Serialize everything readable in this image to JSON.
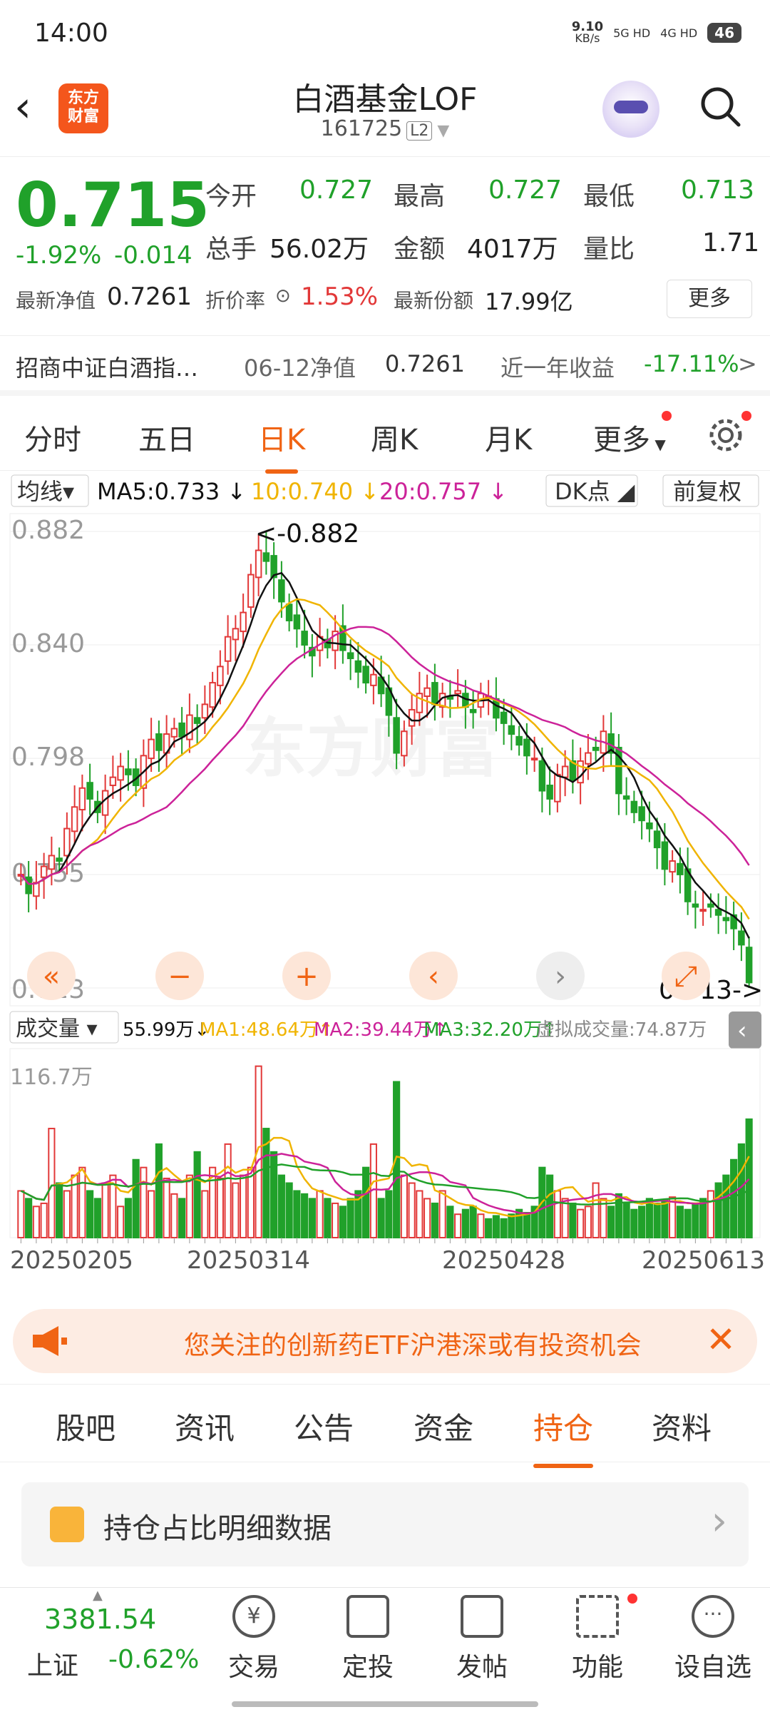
{
  "status": {
    "time": "14:00",
    "net_speed": "9.10",
    "net_unit": "KB/s",
    "sig1": "5G HD",
    "sig2": "4G HD",
    "battery": "46"
  },
  "header": {
    "logo_line1": "东方",
    "logo_line2": "财富",
    "title": "白酒基金LOF",
    "code": "161725",
    "level": "L2"
  },
  "quote": {
    "price": "0.715",
    "change_pct": "-1.92%",
    "change": "-0.014",
    "open_label": "今开",
    "open": "0.727",
    "high_label": "最高",
    "high": "0.727",
    "low_label": "最低",
    "low": "0.713",
    "vol_label": "总手",
    "vol": "56.02万",
    "amount_label": "金额",
    "amount": "4017万",
    "ratio_label": "量比",
    "ratio": "1.71",
    "nav_label": "最新净值",
    "nav": "0.7261",
    "discount_label": "折价率",
    "discount": "1.53%",
    "share_label": "最新份额",
    "share": "17.99亿",
    "more": "更多"
  },
  "index_row": {
    "name": "招商中证白酒指…",
    "date_label": "06-12净值",
    "nav": "0.7261",
    "ret_label": "近一年收益",
    "ret": "-17.11%",
    "arrow": ">"
  },
  "tabs": [
    "分时",
    "五日",
    "日K",
    "周K",
    "月K",
    "更多"
  ],
  "active_tab": 2,
  "colors": {
    "up": "#e23838",
    "down": "#20a12a",
    "accent": "#f06414",
    "ma5": "#111111",
    "ma10": "#f0b400",
    "ma20": "#cc2299"
  },
  "chart_controls": {
    "ma_select": "均线",
    "ma5": "MA5:0.733 ↓",
    "ma10": "10:0.740 ↓",
    "ma20": "20:0.757 ↓",
    "dk": "DK点",
    "adj": "前复权"
  },
  "vol_controls": {
    "label": "成交量",
    "v": "55.99万↓",
    "ma1": "MA1:48.64万↑",
    "ma2": "MA2:39.44万↑",
    "ma3": "MA3:32.20万↑",
    "virtual": "虚拟成交量:74.87万"
  },
  "chart_data": {
    "type": "candlestick",
    "y_ticks": [
      "0.882",
      "0.840",
      "0.798",
      "0.755",
      "0.713"
    ],
    "ylim": [
      0.713,
      0.882
    ],
    "max_label": "<-0.882",
    "min_label": "0.713->",
    "vol_max_label": "116.7万",
    "x_labels": [
      "20250205",
      "20250314",
      "20250428",
      "20250613"
    ],
    "closes": [
      0.755,
      0.748,
      0.752,
      0.758,
      0.762,
      0.76,
      0.772,
      0.78,
      0.787,
      0.783,
      0.778,
      0.786,
      0.791,
      0.795,
      0.792,
      0.788,
      0.799,
      0.805,
      0.801,
      0.807,
      0.809,
      0.806,
      0.814,
      0.811,
      0.818,
      0.826,
      0.832,
      0.843,
      0.846,
      0.852,
      0.866,
      0.875,
      0.871,
      0.865,
      0.856,
      0.849,
      0.846,
      0.84,
      0.836,
      0.843,
      0.839,
      0.845,
      0.838,
      0.835,
      0.83,
      0.826,
      0.829,
      0.822,
      0.814,
      0.8,
      0.808,
      0.816,
      0.822,
      0.824,
      0.818,
      0.822,
      0.82,
      0.823,
      0.817,
      0.815,
      0.822,
      0.821,
      0.813,
      0.811,
      0.807,
      0.803,
      0.799,
      0.798,
      0.786,
      0.783,
      0.792,
      0.795,
      0.79,
      0.797,
      0.8,
      0.801,
      0.808,
      0.8,
      0.785,
      0.783,
      0.778,
      0.775,
      0.772,
      0.765,
      0.757,
      0.76,
      0.755,
      0.745,
      0.743,
      0.742,
      0.743,
      0.74,
      0.738,
      0.735,
      0.729,
      0.715
    ],
    "volume": [
      30,
      25,
      20,
      22,
      70,
      35,
      30,
      40,
      45,
      30,
      25,
      35,
      40,
      20,
      25,
      50,
      45,
      30,
      60,
      38,
      28,
      25,
      40,
      55,
      30,
      45,
      38,
      60,
      35,
      40,
      45,
      110,
      70,
      55,
      40,
      35,
      30,
      28,
      25,
      30,
      25,
      22,
      20,
      25,
      30,
      45,
      60,
      25,
      30,
      100,
      40,
      35,
      30,
      25,
      22,
      30,
      20,
      15,
      18,
      20,
      15,
      12,
      14,
      12,
      15,
      18,
      16,
      20,
      45,
      40,
      30,
      25,
      22,
      18,
      20,
      35,
      25,
      20,
      28,
      22,
      18,
      20,
      25,
      22,
      24,
      26,
      20,
      18,
      22,
      25,
      30,
      35,
      40,
      50,
      60,
      76
    ]
  },
  "chart_buttons": [
    "«",
    "−",
    "+",
    "‹",
    "›",
    "⤢"
  ],
  "banner": {
    "text": "您关注的创新药ETF沪港深或有投资机会",
    "close": "✕"
  },
  "subtabs": [
    "股吧",
    "资讯",
    "公告",
    "资金",
    "持仓",
    "资料"
  ],
  "active_subtab": 4,
  "hold_row": {
    "label": "持仓占比明细数据",
    "arrow": "›"
  },
  "bottom": {
    "index_value": "3381.54",
    "index_name": "上证",
    "index_change": "-0.62%",
    "items": [
      "交易",
      "定投",
      "发帖",
      "功能",
      "设自选"
    ]
  }
}
